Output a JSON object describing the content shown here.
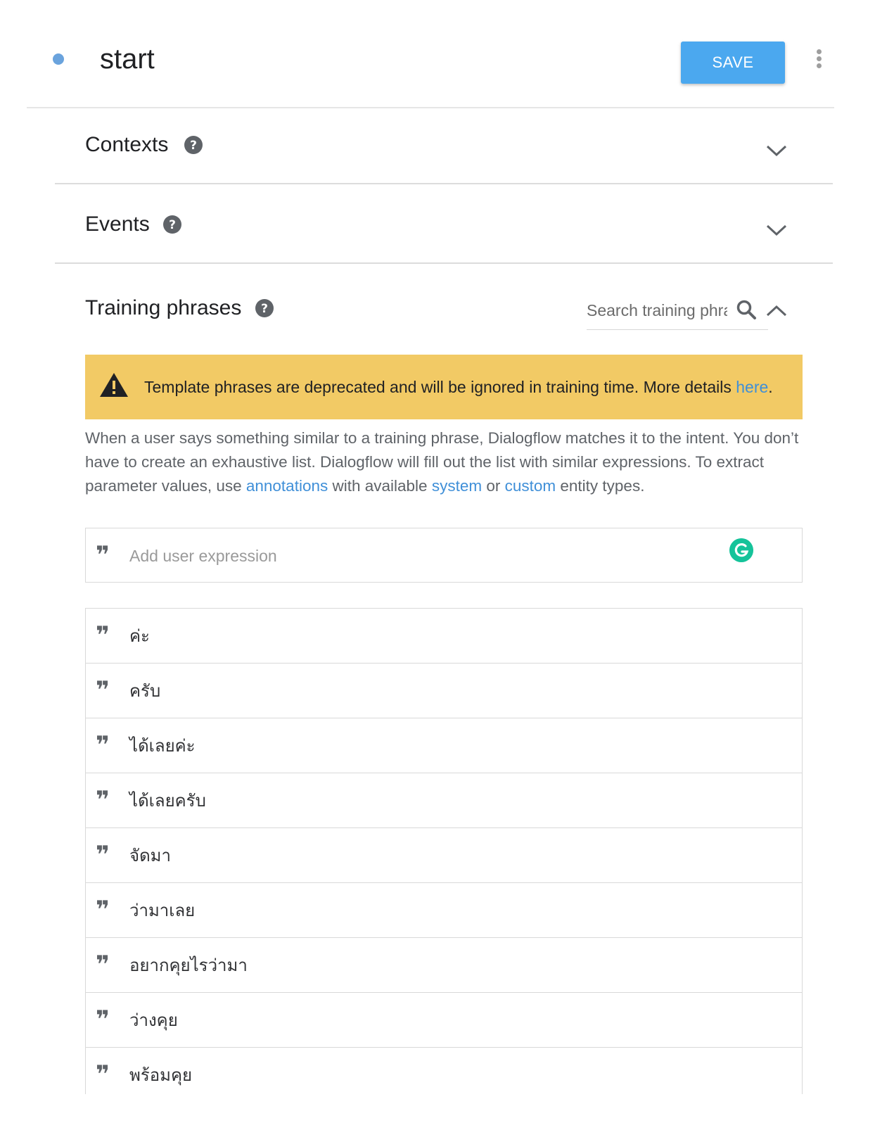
{
  "header": {
    "intent_name": "start",
    "save_label": "SAVE"
  },
  "contexts": {
    "title": "Contexts"
  },
  "events": {
    "title": "Events"
  },
  "training": {
    "title": "Training phrases",
    "search_placeholder": "Search training phrases",
    "warning": {
      "text": "Template phrases are deprecated and will be ignored in training time. More details ",
      "link": "here",
      "suffix": "."
    },
    "description": {
      "part1": "When a user says something similar to a training phrase, Dialogflow matches it to the intent. You don’t have to create an exhaustive list. Dialogflow will fill out the list with similar expressions. To extract parameter values, use ",
      "link_annotations": "annotations",
      "part2": " with available ",
      "link_system": "system",
      "part3": " or ",
      "link_custom": "custom",
      "part4": " entity types."
    },
    "add_placeholder": "Add user expression",
    "phrases": [
      "ค่ะ",
      "ครับ",
      "ได้เลยค่ะ",
      "ได้เลยครับ",
      "จัดมา",
      "ว่ามาเลย",
      "อยากคุยไรว่ามา",
      "ว่างคุย",
      "พร้อมคุย"
    ]
  },
  "colors": {
    "accent": "#4ba8ef",
    "warning_bg": "#f2ca65",
    "link": "#3f8fd8",
    "grammarly": "#15c39a"
  },
  "icons": [
    "help-icon",
    "chevron-down-icon",
    "chevron-up-icon",
    "search-icon",
    "warning-icon",
    "quote-icon",
    "grammarly-icon",
    "more-vert-icon"
  ]
}
